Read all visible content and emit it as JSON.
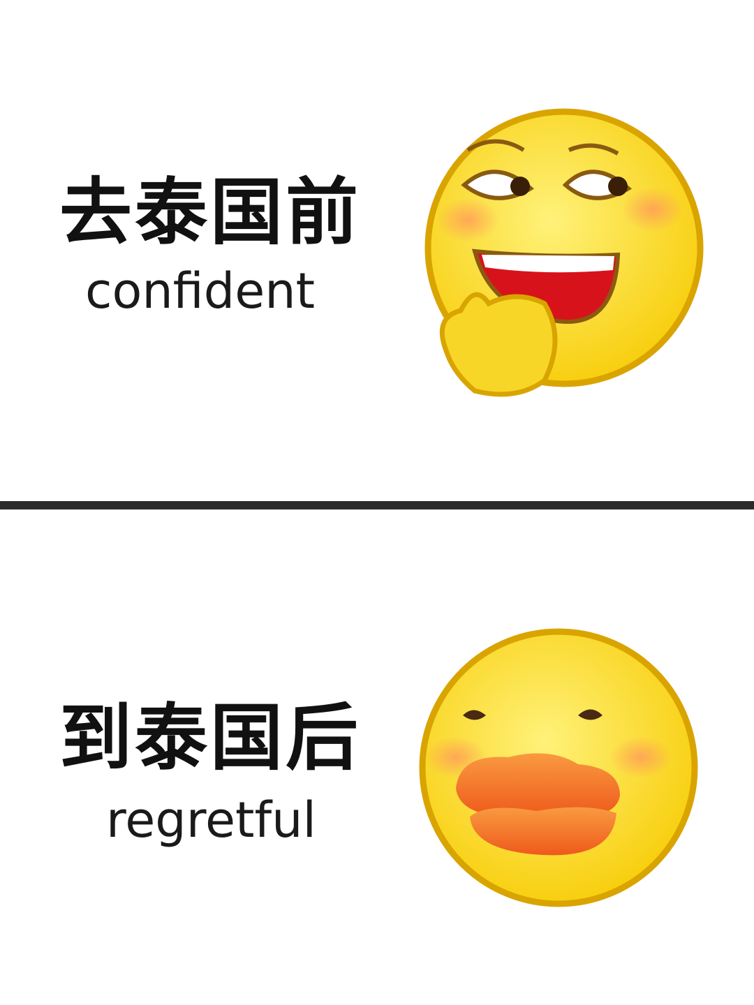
{
  "panels": [
    {
      "caption_cn": "去泰国前",
      "caption_en": "confident",
      "emoji": "smirking-laughing-face-icon"
    },
    {
      "caption_cn": "到泰国后",
      "caption_en": "regretful",
      "emoji": "duck-lips-face-icon"
    }
  ],
  "colors": {
    "face": "#fcd921",
    "outline": "#d9a400",
    "divider": "#2a2a2a",
    "lips": "#f47a2a",
    "mouth": "#d8121a"
  }
}
